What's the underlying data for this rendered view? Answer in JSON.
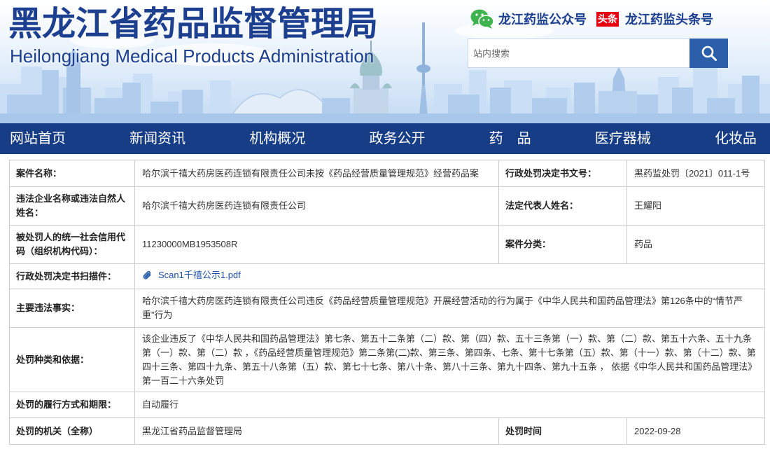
{
  "site": {
    "title_cn": "黑龙江省药品监督管理局",
    "title_en": "Heilongjiang Medical Products Administration"
  },
  "social": {
    "wechat_label": "龙江药监公众号",
    "toutiao_badge": "头条",
    "toutiao_label": "龙江药监头条号"
  },
  "search": {
    "placeholder": "站内搜索"
  },
  "nav": {
    "items": [
      {
        "label": "网站首页"
      },
      {
        "label": "新闻资讯"
      },
      {
        "label": "机构概况"
      },
      {
        "label": "政务公开"
      },
      {
        "label": "药　品"
      },
      {
        "label": "医疗器械"
      },
      {
        "label": "化妆品"
      }
    ]
  },
  "case": {
    "name": {
      "label": "案件名称：",
      "value": "哈尔滨千禧大药房医药连锁有限责任公司未按《药品经营质量管理规范》经营药品案"
    },
    "decision_no": {
      "label": "行政处罚决定书文号：",
      "value": "黑药监处罚〔2021〕011-1号"
    },
    "party": {
      "label": "违法企业名称或违法自然人姓名：",
      "value": "哈尔滨千禧大药房医药连锁有限责任公司"
    },
    "legal_rep": {
      "label": "法定代表人姓名：",
      "value": "王耀阳"
    },
    "credit_code": {
      "label": "被处罚人的统一社会信用代码（组织机构代码）：",
      "value": "11230000MB1953508R"
    },
    "category": {
      "label": "案件分类：",
      "value": "药品"
    },
    "scan": {
      "label": "行政处罚决定书扫描件：",
      "file_name": "Scan1千禧公示1.pdf"
    },
    "facts": {
      "label": "主要违法事实：",
      "value": "哈尔滨千禧大药房医药连锁有限责任公司违反《药品经营质量管理规范》开展经营活动的行为属于《中华人民共和国药品管理法》第126条中的“情节严重”行为"
    },
    "basis": {
      "label": "处罚种类和依据：",
      "value": "该企业违反了《中华人民共和国药品管理法》第七条、第五十二条第（二）款、第（四）款、五十三条第（一）款、第（二）款、第五十六条、五十九条第（一）款、第（二）款 ，《药品经营质量管理规范》第二条第(二)款、第三条、第四条、七条、第十七条第（五）款、第（十一）款、第（十二）款、第四十三条、第四十九条、第五十八条第（五）款、第七十七条、第八十条、第八十三条、第九十四条、第九十五条 ， 依据《中华人民共和国药品管理法》第一百二十六条处罚"
    },
    "fulfillment": {
      "label": "处罚的履行方式和期限：",
      "value": "自动履行"
    },
    "authority": {
      "label": "处罚的机关（全称）",
      "value": "黑龙江省药品监督管理局"
    },
    "date": {
      "label": "处罚时间",
      "value": "2022-09-28"
    }
  },
  "icons": {
    "wechat": "wechat-icon",
    "search": "search-icon",
    "attachment": "paperclip-icon"
  },
  "colors": {
    "brand_navy": "#1d3f8f",
    "nav_bg": "#173d86",
    "search_button": "#2c5fa9",
    "link": "#1f4fa5",
    "toutiao_red": "#e60012",
    "wechat_green": "#3fb34f",
    "table_border": "#cccccc"
  }
}
